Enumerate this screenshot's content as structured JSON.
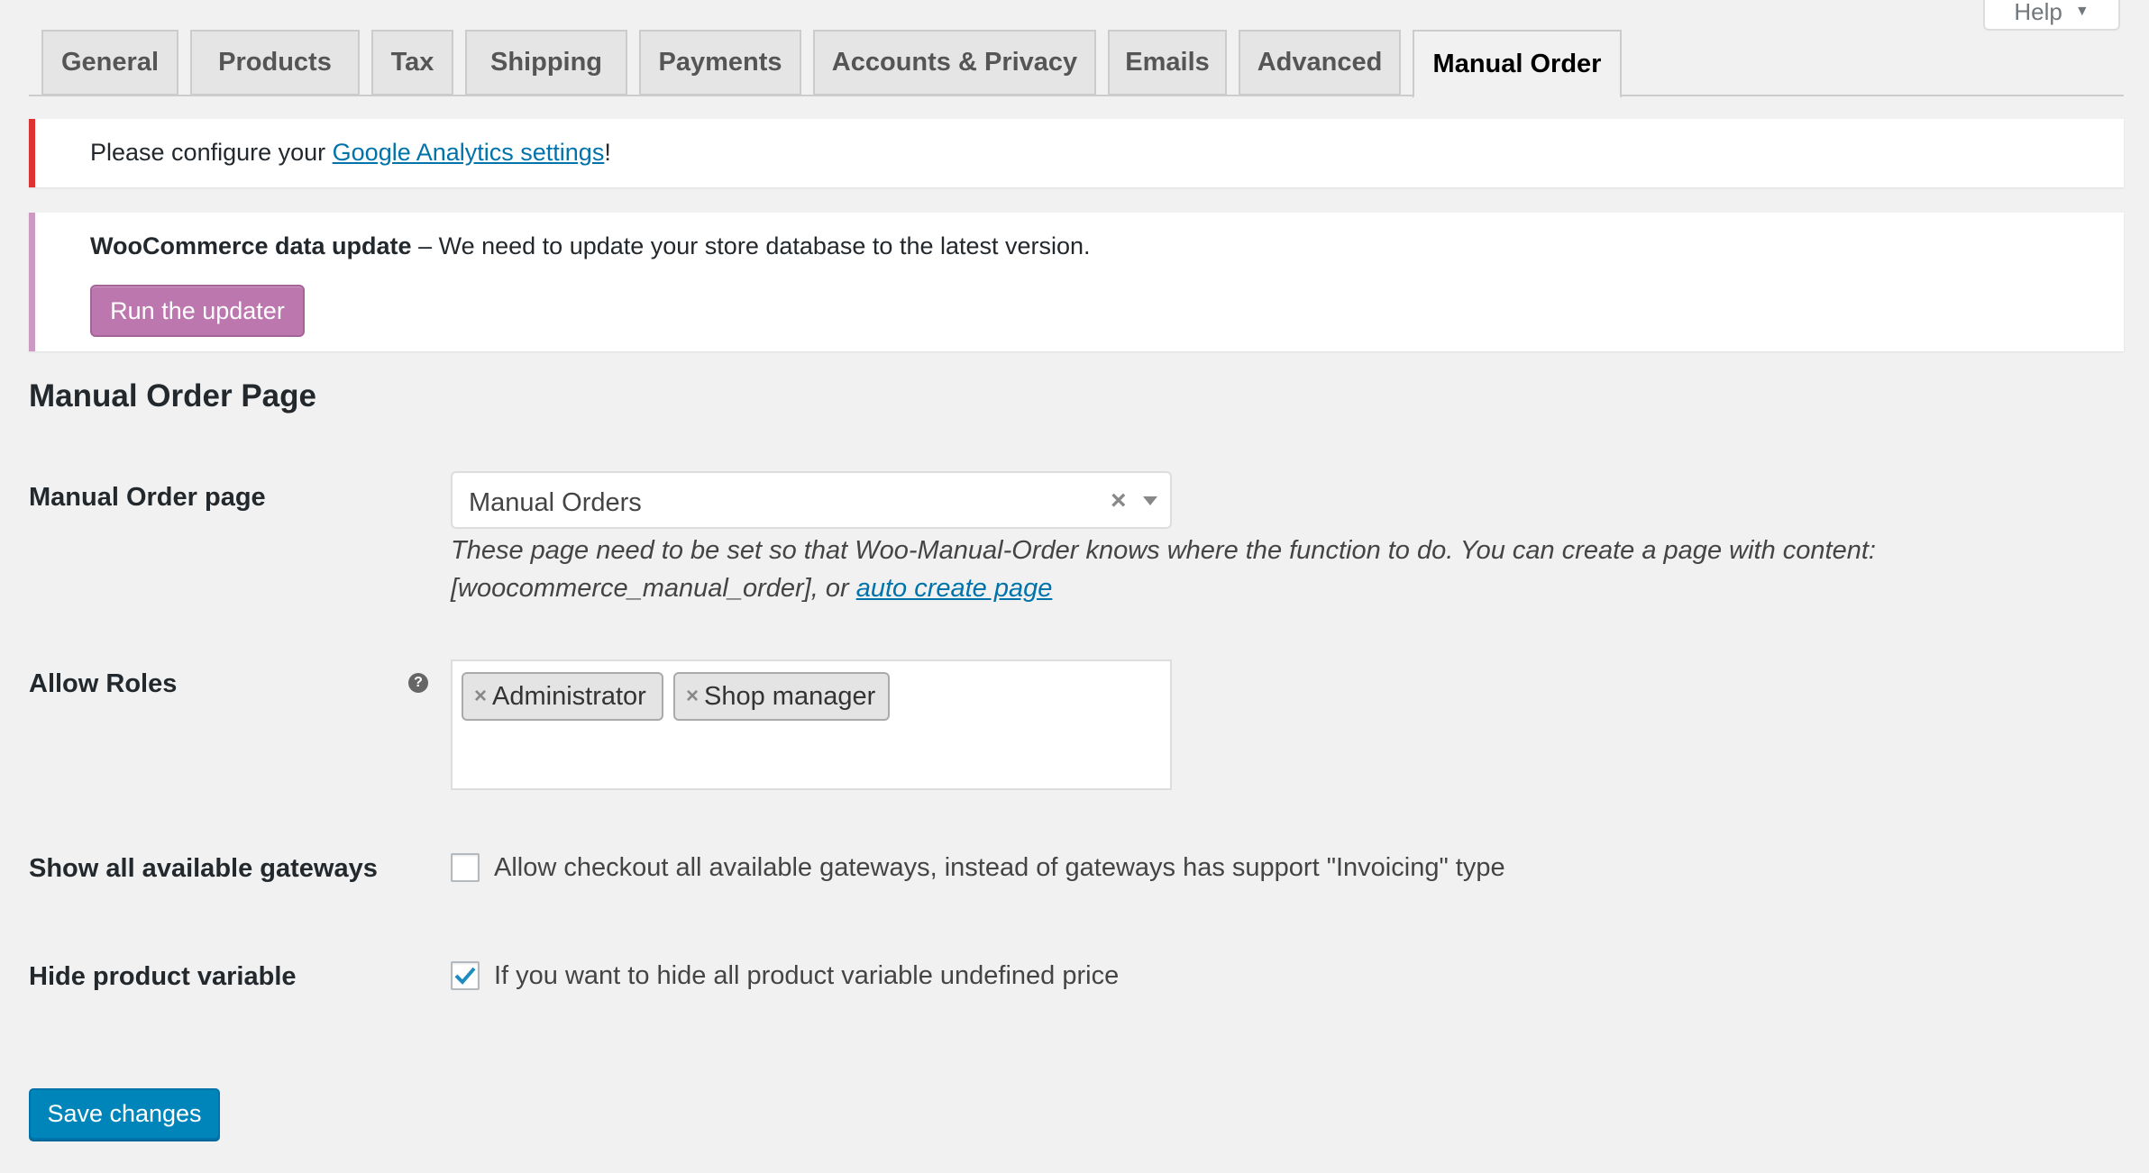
{
  "help": {
    "label": "Help"
  },
  "tabs": [
    {
      "label": "General"
    },
    {
      "label": "Products"
    },
    {
      "label": "Tax"
    },
    {
      "label": "Shipping"
    },
    {
      "label": "Payments"
    },
    {
      "label": "Accounts & Privacy"
    },
    {
      "label": "Emails"
    },
    {
      "label": "Advanced"
    },
    {
      "label": "Manual Order",
      "active": true
    }
  ],
  "notices": {
    "analytics": {
      "prefix": "Please configure your ",
      "link": "Google Analytics settings",
      "suffix": "!"
    },
    "update": {
      "strong": "WooCommerce data update",
      "text": " – We need to update your store database to the latest version.",
      "button": "Run the updater"
    }
  },
  "section": {
    "title": "Manual Order Page"
  },
  "fields": {
    "manual_order_page": {
      "label": "Manual Order page",
      "value": "Manual Orders",
      "clear": "×",
      "desc_line1": "These page need to be set so that Woo-Manual-Order knows where the function to do. You can create a page with content:",
      "desc_line2_prefix": "[woocommerce_manual_order], or ",
      "desc_link": "auto create page"
    },
    "allow_roles": {
      "label": "Allow Roles",
      "help": "?",
      "chips": [
        {
          "x": "×",
          "label": "Administrator"
        },
        {
          "x": "×",
          "label": "Shop manager"
        }
      ]
    },
    "show_gateways": {
      "label": "Show all available gateways",
      "checkbox_label": "Allow checkout all available gateways, instead of gateways has support \"Invoicing\" type",
      "checked": false
    },
    "hide_variable": {
      "label": "Hide product variable",
      "checkbox_label": "If you want to hide all product variable undefined price",
      "checked": true
    }
  },
  "save": {
    "label": "Save changes"
  },
  "colors": {
    "error_border": "#dc3232",
    "update_border": "#cc99c2",
    "woo_button": "#bb77ae",
    "primary_button": "#0085ba",
    "link": "#0073aa",
    "check": "#1e8cbe"
  }
}
